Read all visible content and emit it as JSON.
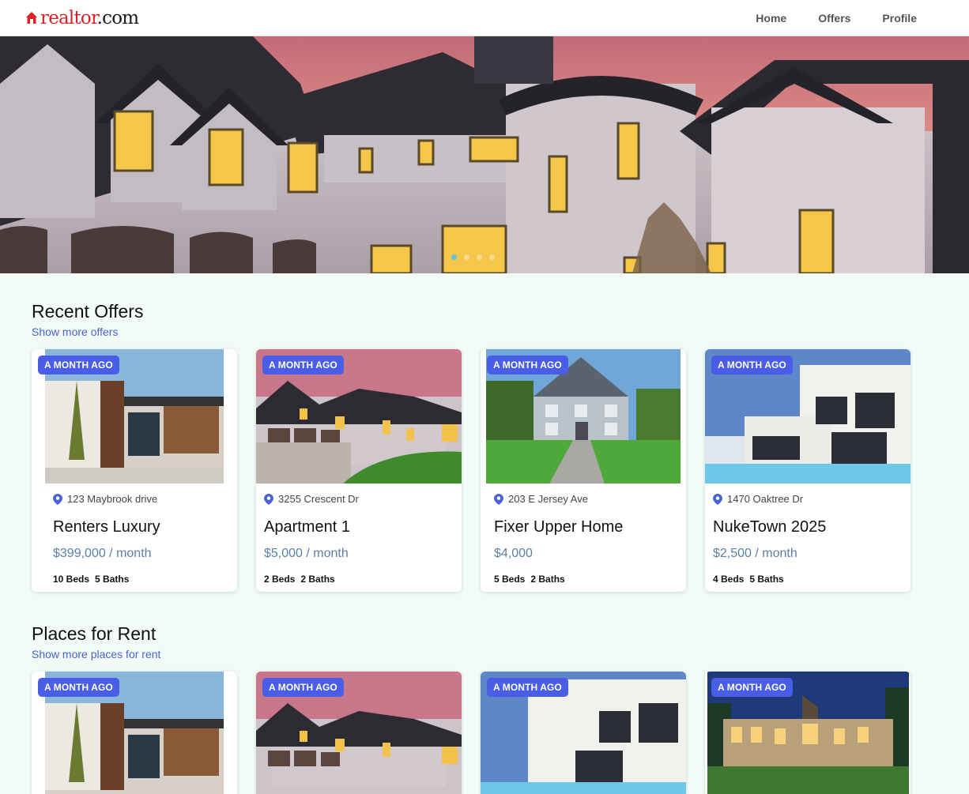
{
  "brand": {
    "logo": "realtor.com",
    "red": "realtor",
    "dark": ".com"
  },
  "nav": {
    "links": [
      "Home",
      "Offers",
      "Profile"
    ]
  },
  "hero": {
    "slides": 4,
    "active_slide": 1
  },
  "recent": {
    "title": "Recent Offers",
    "more": "Show more offers",
    "cards": [
      {
        "badge": "A MONTH AGO",
        "address": "123 Maybrook drive",
        "name": "Renters Luxury",
        "price": "$399,000 / month",
        "beds": "10 Beds",
        "baths": "5 Baths"
      },
      {
        "badge": "A MONTH AGO",
        "address": "3255 Crescent Dr",
        "name": "Apartment 1",
        "price": "$5,000 / month",
        "beds": "2 Beds",
        "baths": "2 Baths"
      },
      {
        "badge": "A MONTH AGO",
        "address": "203 E Jersey Ave",
        "name": "Fixer Upper Home",
        "price": "$4,000",
        "beds": "5 Beds",
        "baths": "2 Baths"
      },
      {
        "badge": "A MONTH AGO",
        "address": "1470 Oaktree Dr",
        "name": "NukeTown 2025",
        "price": "$2,500 / month",
        "beds": "4 Beds",
        "baths": "5 Baths"
      }
    ]
  },
  "rent": {
    "title": "Places for Rent",
    "more": "Show more places for rent",
    "cards": [
      {
        "badge": "A MONTH AGO"
      },
      {
        "badge": "A MONTH AGO"
      },
      {
        "badge": "A MONTH AGO"
      },
      {
        "badge": "A MONTH AGO"
      }
    ]
  },
  "colors": {
    "accent": "#4a5de6",
    "brand_red": "#d92228",
    "link": "#4a63d6",
    "price": "#5c7fa6",
    "page_bg": "#f2fbf5"
  },
  "icons": {
    "pin": "map-pin-icon",
    "logo": "house-icon"
  }
}
